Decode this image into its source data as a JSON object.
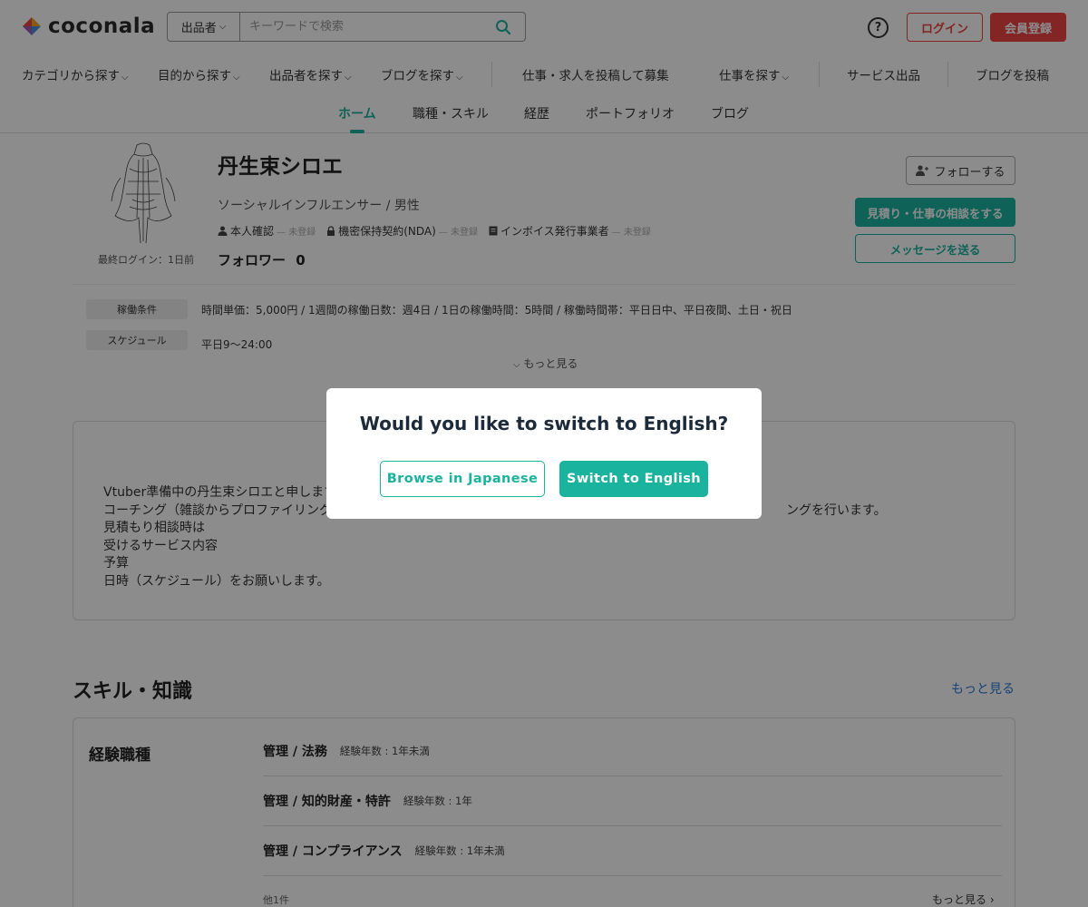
{
  "header": {
    "logo_text": "coconala",
    "search": {
      "category": "出品者",
      "placeholder": "キーワードで検索"
    },
    "help_glyph": "?",
    "login_label": "ログイン",
    "register_label": "会員登録",
    "brand_color": "#e44444",
    "accent_color": "#1ab39e"
  },
  "nav": {
    "items": [
      "カテゴリから探す",
      "目的から探す",
      "出品者を探す",
      "ブログを探す",
      "仕事・求人を投稿して募集",
      "仕事を探す",
      "サービス出品",
      "ブログを投稿"
    ],
    "chevron": "⌵"
  },
  "tabs": [
    "ホーム",
    "職種・スキル",
    "経歴",
    "ポートフォリオ",
    "ブログ"
  ],
  "profile": {
    "name": "丹生束シロエ",
    "role": "ソーシャルインフルエンサー / 男性",
    "last_login": "最終ログイン：1日前",
    "verifications": [
      {
        "label": "本人確認",
        "status": "— 未登録",
        "icon": "person-icon"
      },
      {
        "label": "機密保持契約(NDA)",
        "status": "— 未登録",
        "icon": "lock-icon"
      },
      {
        "label": "インボイス発行事業者",
        "status": "— 未登録",
        "icon": "document-icon"
      }
    ],
    "followers_label": "フォロワー",
    "followers_count": "0",
    "follow_label": "フォローする",
    "quote_label": "見積り・仕事の相談をする",
    "message_label": "メッセージを送る"
  },
  "conditions": [
    {
      "label": "稼働条件",
      "value": "時間単価：5,000円  /  1週間の稼働日数：週4日  /  1日の稼働時間：5時間  /  稼働時間帯：平日日中、平日夜間、土日・祝日"
    },
    {
      "label": "スケジュール",
      "value": "平日9〜24:00"
    }
  ],
  "more_label": "もっと見る",
  "intro": {
    "lines": [
      "Vtuber準備中の丹生束シロエと申します。",
      "コーチング（雑談からプロファイリング",
      "見積もり相談時は",
      "受けるサービス内容",
      "予算",
      "日時（スケジュール）をお願いします。"
    ],
    "line2_tail": "ングを行います。"
  },
  "skills": {
    "title": "スキル・知識",
    "more_label": "もっと見る",
    "heading": "経験職種",
    "rows": [
      {
        "name": "管理 / 法務",
        "exp": "経験年数 : 1年未満"
      },
      {
        "name": "管理 / 知的財産・特許",
        "exp": "経験年数 : 1年"
      },
      {
        "name": "管理 / コンプライアンス",
        "exp": "経験年数 : 1年未満"
      }
    ],
    "other": "他1件",
    "more_bottom": "もっと見る  ›"
  },
  "modal": {
    "title": "Would you like to switch to English?",
    "browse_japanese": "Browse in Japanese",
    "switch_english": "Switch to English"
  }
}
